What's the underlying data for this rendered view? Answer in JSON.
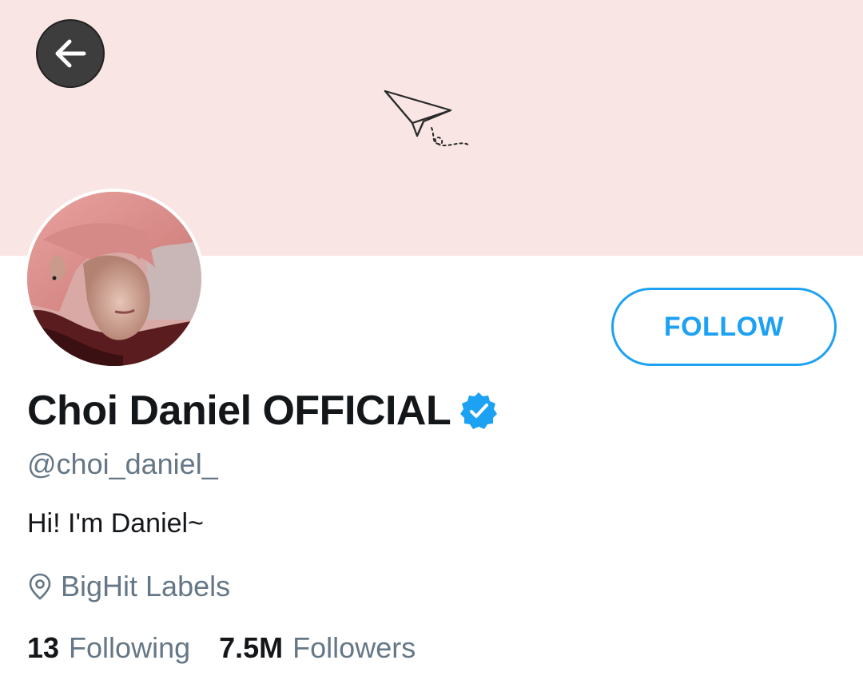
{
  "header": {
    "back_icon": "arrow-left-icon",
    "banner_icon": "paper-plane-icon",
    "banner_color": "#f8e5e4"
  },
  "profile": {
    "display_name": "Choi Daniel OFFICIAL",
    "verified": true,
    "verified_icon": "verified-badge-icon",
    "handle": "@choi_daniel_",
    "bio": "Hi! I'm Daniel~",
    "location_icon": "location-pin-icon",
    "location": "BigHit Labels",
    "follow_label": "FOLLOW",
    "accent_color": "#1da1f2"
  },
  "stats": {
    "following_count": "13",
    "following_label": "Following",
    "followers_count": "7.5M",
    "followers_label": "Followers"
  }
}
